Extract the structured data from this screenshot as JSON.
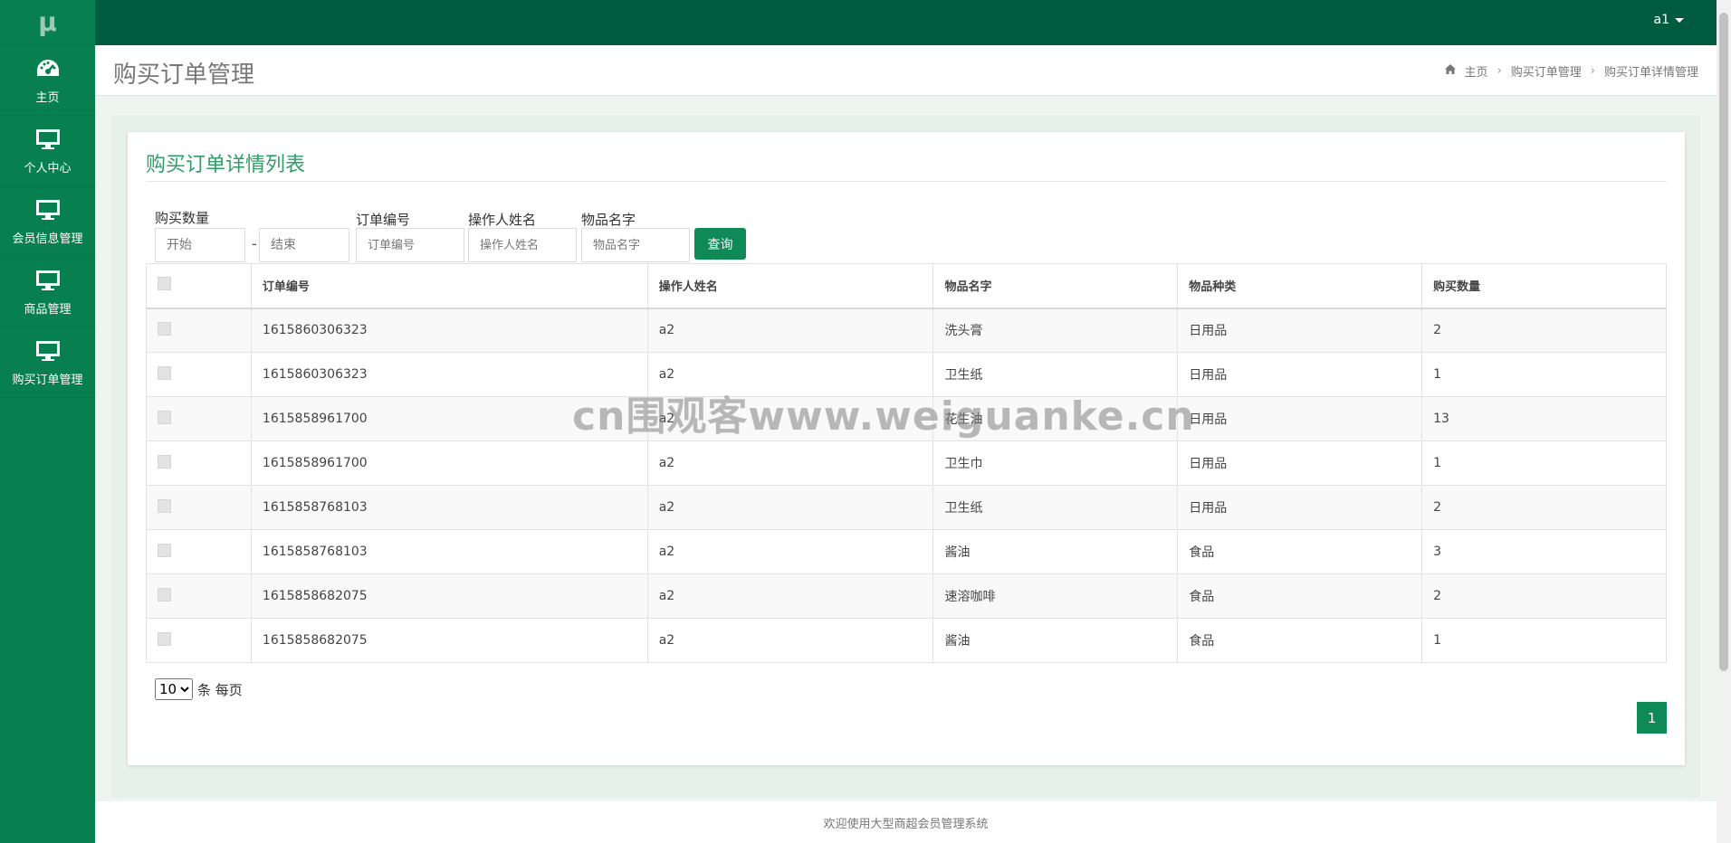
{
  "topbar": {
    "user": "a1"
  },
  "sidebar": {
    "logo": "μ",
    "items": [
      {
        "label": "主页",
        "icon": "dashboard-icon"
      },
      {
        "label": "个人中心",
        "icon": "monitor-icon"
      },
      {
        "label": "会员信息管理",
        "icon": "monitor-icon"
      },
      {
        "label": "商品管理",
        "icon": "monitor-icon"
      },
      {
        "label": "购买订单管理",
        "icon": "monitor-icon"
      }
    ]
  },
  "header": {
    "title": "购买订单管理",
    "breadcrumb": [
      "主页",
      "购买订单管理",
      "购买订单详情管理"
    ]
  },
  "card": {
    "title": "购买订单详情列表",
    "filters": {
      "quantity_label": "购买数量",
      "quantity_start_placeholder": "开始",
      "quantity_end_placeholder": "结束",
      "dash": "-",
      "order_label": "订单编号",
      "order_placeholder": "订单编号",
      "operator_label": "操作人姓名",
      "operator_placeholder": "操作人姓名",
      "item_label": "物品名字",
      "item_placeholder": "物品名字",
      "query_button": "查询"
    },
    "table": {
      "columns": [
        "订单编号",
        "操作人姓名",
        "物品名字",
        "物品种类",
        "购买数量"
      ],
      "rows": [
        [
          "1615860306323",
          "a2",
          "洗头膏",
          "日用品",
          "2"
        ],
        [
          "1615860306323",
          "a2",
          "卫生纸",
          "日用品",
          "1"
        ],
        [
          "1615858961700",
          "a2",
          "花生油",
          "日用品",
          "13"
        ],
        [
          "1615858961700",
          "a2",
          "卫生巾",
          "日用品",
          "1"
        ],
        [
          "1615858768103",
          "a2",
          "卫生纸",
          "日用品",
          "2"
        ],
        [
          "1615858768103",
          "a2",
          "酱油",
          "食品",
          "3"
        ],
        [
          "1615858682075",
          "a2",
          "速溶咖啡",
          "食品",
          "2"
        ],
        [
          "1615858682075",
          "a2",
          "酱油",
          "食品",
          "1"
        ]
      ]
    },
    "pager": {
      "page_size": "10",
      "page_size_text": "条 每页",
      "current_page": "1"
    }
  },
  "footer": {
    "text": "欢迎使用大型商超会员管理系统"
  },
  "watermark": "cn围观客www.weiguanke.cn",
  "colors": {
    "topbar": "#005b3f",
    "sidebar": "#087f4f",
    "accent": "#0f8a57",
    "title_green": "#2e9e66"
  }
}
